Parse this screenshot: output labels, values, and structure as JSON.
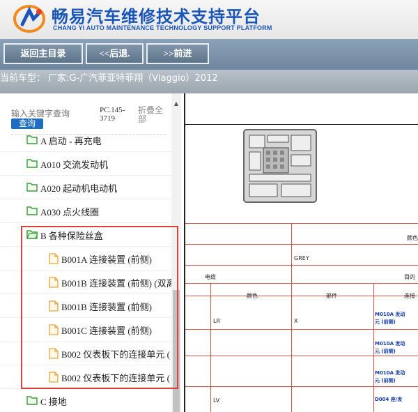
{
  "header": {
    "title_cn": "畅易汽车维修技术支持平台",
    "title_en": "CHANG YI AUTO MAINTENANCE TECHNOLOGY SUPPORT PLATFORM",
    "logo_icon": "cy-logo"
  },
  "nav": {
    "home": "返回主目录",
    "back": "<<后退.",
    "forward": ">>前进"
  },
  "vehicle": {
    "label": "当前车型： 厂家:G-广汽菲亚特菲翔（Viaggio）2012"
  },
  "left": {
    "search_placeholder": "输入关键字查询",
    "search_button": "查询",
    "code": "PC.145-3719",
    "collapse": "折叠全部",
    "items": [
      {
        "label": "A 启动 - 再充电",
        "icon": "folder-icon"
      },
      {
        "label": "A010 交流发动机",
        "icon": "folder-icon"
      },
      {
        "label": "A020 起动机电动机",
        "icon": "folder-icon"
      },
      {
        "label": "A030 点火线圈",
        "icon": "folder-icon"
      },
      {
        "label": "B 各种保险丝盒",
        "icon": "folder-open-icon"
      },
      {
        "label": "B001A 连接装置 (前侧)",
        "icon": "document-icon"
      },
      {
        "label": "B001B 连接装置 (前侧) (双离",
        "icon": "document-icon"
      },
      {
        "label": "B001B 连接装置 (前侧)",
        "icon": "document-icon"
      },
      {
        "label": "B001C 连接装置 (前侧)",
        "icon": "document-icon"
      },
      {
        "label": "B002 仪表板下的连接单元 (",
        "icon": "document-icon"
      },
      {
        "label": "B002 仪表板下的连接单元 (",
        "icon": "document-icon"
      },
      {
        "label": "C 接地",
        "icon": "folder-icon"
      }
    ]
  },
  "doc": {
    "color_header": "颜色",
    "grey": "GREY",
    "cable": "电缆",
    "dest": "目的",
    "col_color": "颜色",
    "col_part": "部件",
    "col_conn": "连接",
    "rows": [
      {
        "color": "LR",
        "part": "X",
        "conn1": "M010A 发动",
        "conn2": "元 (前侧)"
      },
      {
        "color": "",
        "part": "",
        "conn1": "M010A 发动",
        "conn2": "元 (前侧)"
      },
      {
        "color": "",
        "part": "",
        "conn1": "M010A 发动",
        "conn2": "元 (前侧)"
      },
      {
        "color": "LV",
        "part": "",
        "conn1": "D004 座/发",
        "conn2": ""
      }
    ]
  },
  "colors": {
    "brand": "#1a56b8",
    "nav": "#6f879e",
    "highlight": "#d8423e",
    "grid": "#d9534f",
    "folder": "#3a9b3a",
    "doc": "#e6a23c"
  }
}
